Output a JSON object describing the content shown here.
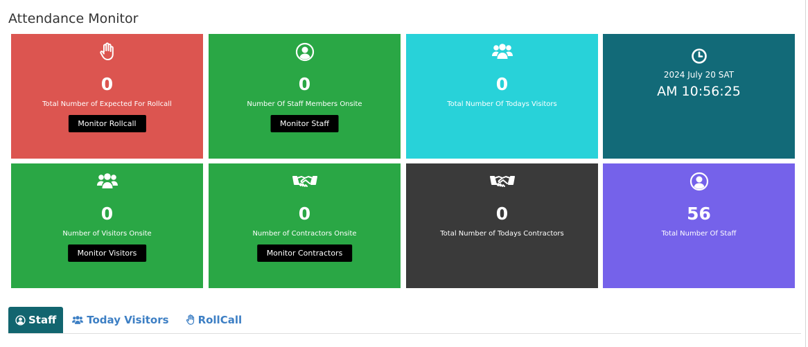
{
  "page": {
    "title": "Attendance Monitor"
  },
  "cards": {
    "expected_rollcall": {
      "value": "0",
      "caption": "Total Number of Expected For Rollcall",
      "button": "Monitor Rollcall",
      "color": "#dc5550",
      "icon": "hand-icon"
    },
    "staff_onsite": {
      "value": "0",
      "caption": "Number Of Staff Members Onsite",
      "button": "Monitor Staff",
      "color": "#2aa745",
      "icon": "user-circle-icon"
    },
    "todays_visitors": {
      "value": "0",
      "caption": "Total Number Of Todays Visitors",
      "color": "#28d2d9",
      "icon": "users-icon"
    },
    "clock": {
      "date": "2024 July 20 SAT",
      "time": "AM 10:56:25",
      "color": "#126a78",
      "icon": "clock-icon"
    },
    "visitors_onsite": {
      "value": "0",
      "caption": "Number of Visitors Onsite",
      "button": "Monitor Visitors",
      "color": "#2aa745",
      "icon": "users-icon"
    },
    "contractors_onsite": {
      "value": "0",
      "caption": "Number of Contractors Onsite",
      "button": "Monitor Contractors",
      "color": "#2aa745",
      "icon": "handshake-icon"
    },
    "todays_contractors": {
      "value": "0",
      "caption": "Total Number of Todays Contractors",
      "color": "#3a3a3a",
      "icon": "handshake-icon"
    },
    "total_staff": {
      "value": "56",
      "caption": "Total Number Of Staff",
      "color": "#7562ea",
      "icon": "user-circle-icon"
    }
  },
  "tabs": [
    {
      "label": "Staff",
      "active": true,
      "icon": "user-circle-icon"
    },
    {
      "label": "Today Visitors",
      "active": false,
      "icon": "users-icon"
    },
    {
      "label": "RollCall",
      "active": false,
      "icon": "hand-icon"
    }
  ]
}
